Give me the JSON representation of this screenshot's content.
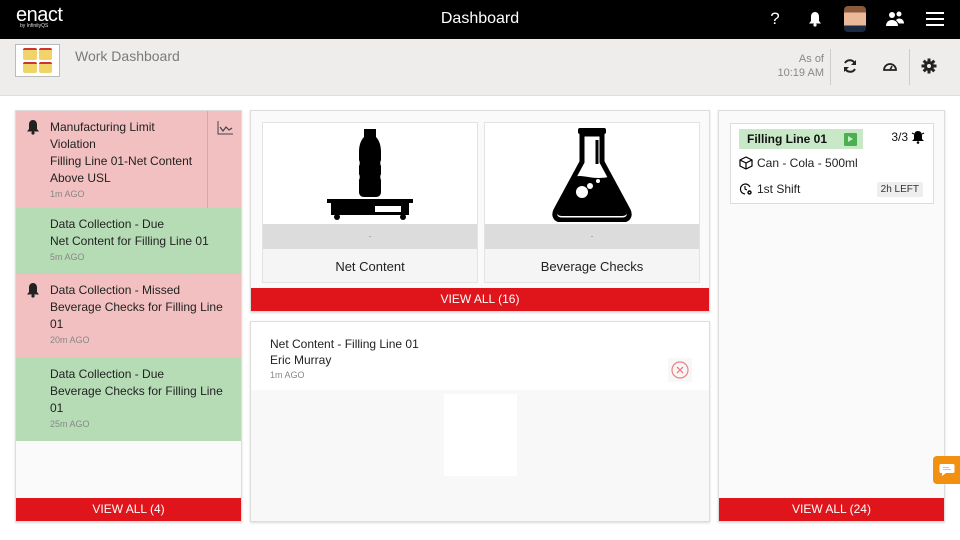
{
  "app": {
    "logo": "enact",
    "logo_sub": "by InfinityQS",
    "title": "Dashboard",
    "top_icons": [
      "help-icon",
      "bell-icon",
      "user-avatar",
      "users-icon",
      "menu-icon"
    ],
    "help_glyph": "?"
  },
  "subheader": {
    "title": "Work Dashboard",
    "as_of_label": "As of",
    "as_of_time": "10:19 AM",
    "icons": [
      "refresh-icon",
      "gauge-icon",
      "gear-icon"
    ]
  },
  "notifications": {
    "items": [
      {
        "type": "alarm",
        "color": "red",
        "title": "Manufacturing Limit Violation",
        "detail": "Filling Line 01-Net Content Above USL",
        "ago": "1m AGO",
        "has_chart": true
      },
      {
        "type": "due",
        "color": "green",
        "title": "Data Collection - Due",
        "detail": "Net Content for Filling Line 01",
        "ago": "5m AGO"
      },
      {
        "type": "missed",
        "color": "red",
        "title": "Data Collection - Missed",
        "detail": "Beverage Checks for Filling Line 01",
        "ago": "20m AGO"
      },
      {
        "type": "due",
        "color": "green",
        "title": "Data Collection - Due",
        "detail": "Beverage Checks for Filling Line 01",
        "ago": "25m AGO"
      }
    ],
    "view_all": "VIEW ALL  (4)"
  },
  "data_collections": {
    "tiles": [
      {
        "label": "Net Content",
        "status": ".",
        "icon": "bottle-scale-icon"
      },
      {
        "label": "Beverage Checks",
        "status": ".",
        "icon": "flask-icon"
      }
    ],
    "view_all": "VIEW ALL  (16)"
  },
  "recent": {
    "title": "Net Content - Filling Line 01",
    "user": "Eric Murray",
    "ago": "1m AGO"
  },
  "lines": {
    "items": [
      {
        "name": "Filling Line 01",
        "count": "3/3",
        "product": "Can - Cola - 500ml",
        "shift": "1st Shift",
        "time_left": "2h LEFT"
      }
    ],
    "view_all": "VIEW ALL  (24)"
  },
  "colors": {
    "accent_red": "#e0141b",
    "alert_bg": "#f2c0c0",
    "ok_bg": "#b6dcb6",
    "chat_orange": "#f29010"
  }
}
